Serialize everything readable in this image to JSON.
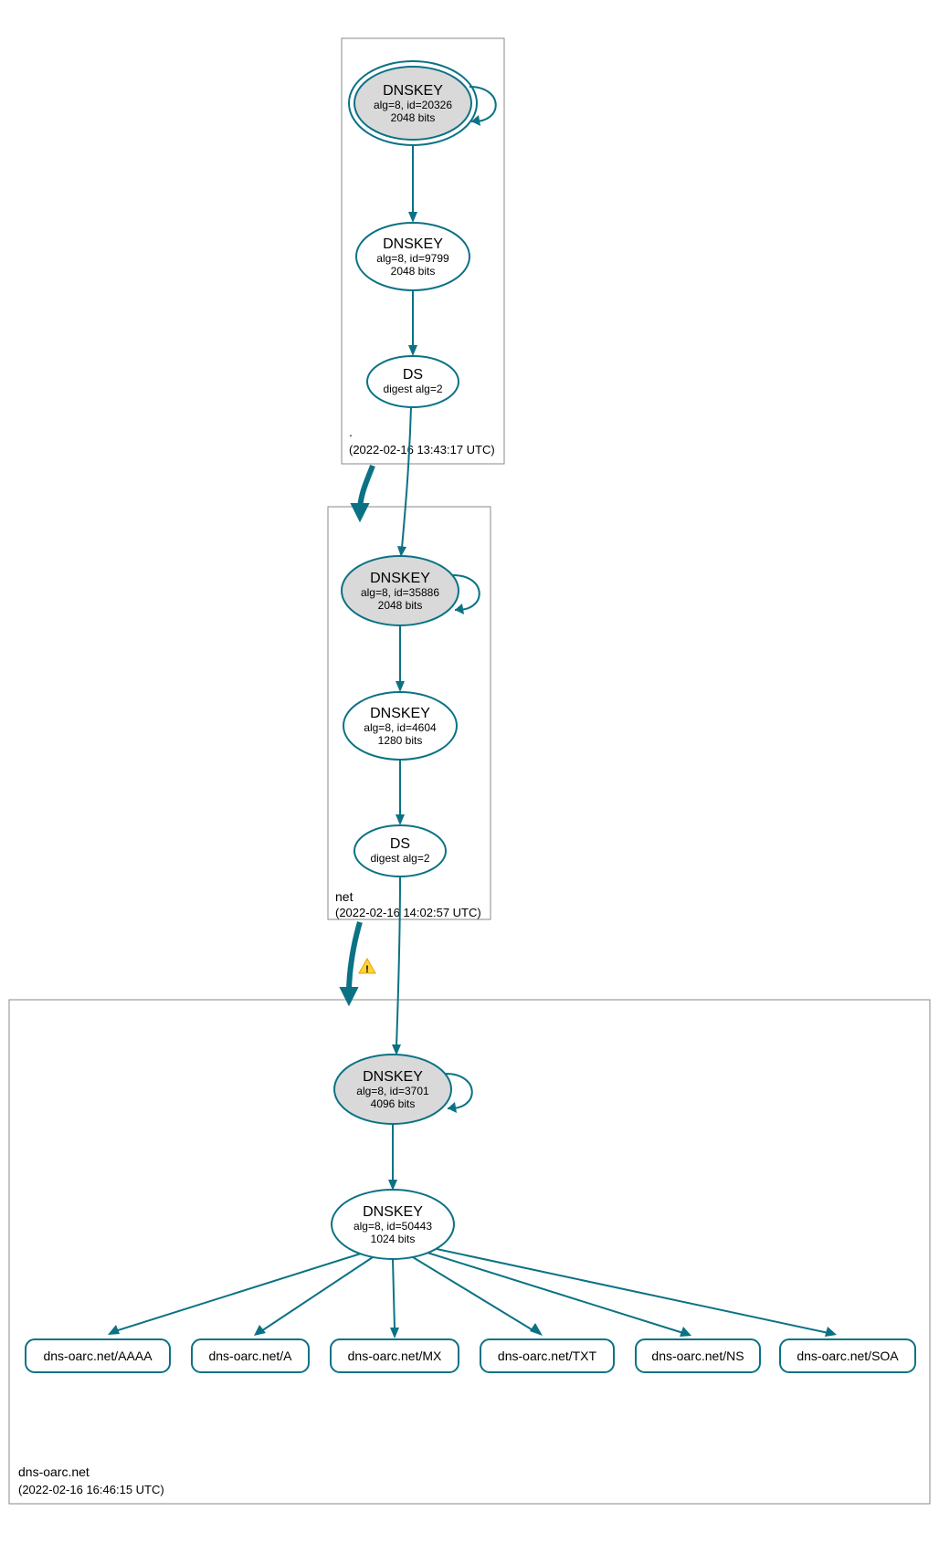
{
  "zones": {
    "root": {
      "label": ".",
      "timestamp": "(2022-02-16 13:43:17 UTC)"
    },
    "net": {
      "label": "net",
      "timestamp": "(2022-02-16 14:02:57 UTC)"
    },
    "leaf": {
      "label": "dns-oarc.net",
      "timestamp": "(2022-02-16 16:46:15 UTC)"
    }
  },
  "nodes": {
    "root_ksk": {
      "title": "DNSKEY",
      "line1": "alg=8, id=20326",
      "line2": "2048 bits"
    },
    "root_zsk": {
      "title": "DNSKEY",
      "line1": "alg=8, id=9799",
      "line2": "2048 bits"
    },
    "root_ds": {
      "title": "DS",
      "line1": "digest alg=2"
    },
    "net_ksk": {
      "title": "DNSKEY",
      "line1": "alg=8, id=35886",
      "line2": "2048 bits"
    },
    "net_zsk": {
      "title": "DNSKEY",
      "line1": "alg=8, id=4604",
      "line2": "1280 bits"
    },
    "net_ds": {
      "title": "DS",
      "line1": "digest alg=2"
    },
    "leaf_ksk": {
      "title": "DNSKEY",
      "line1": "alg=8, id=3701",
      "line2": "4096 bits"
    },
    "leaf_zsk": {
      "title": "DNSKEY",
      "line1": "alg=8, id=50443",
      "line2": "1024 bits"
    }
  },
  "records": {
    "aaaa": "dns-oarc.net/AAAA",
    "a": "dns-oarc.net/A",
    "mx": "dns-oarc.net/MX",
    "txt": "dns-oarc.net/TXT",
    "ns": "dns-oarc.net/NS",
    "soa": "dns-oarc.net/SOA"
  }
}
